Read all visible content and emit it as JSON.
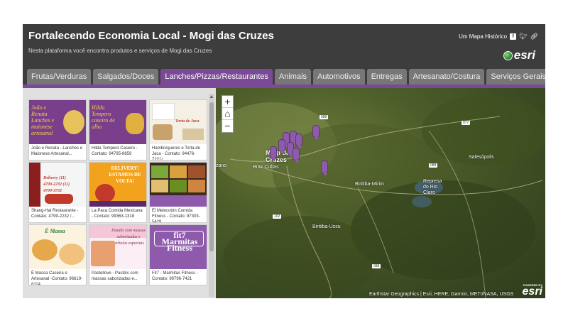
{
  "header": {
    "title": "Fortalecendo Economia Local - Mogi das Cruzes",
    "subtitle": "Nesta plataforma você encontra produtos e serviços de Mogi das Cruzes",
    "story_label": "Um Mapa Histórico",
    "logo_text": "esri"
  },
  "tabs": [
    {
      "label": "Frutas/Verduras"
    },
    {
      "label": "Salgados/Doces"
    },
    {
      "label": "Lanches/Pizzas/Restaurantes"
    },
    {
      "label": "Animais"
    },
    {
      "label": "Automotivos"
    },
    {
      "label": "Entregas"
    },
    {
      "label": "Artesanato/Costura"
    },
    {
      "label": "Serviços Gerais"
    }
  ],
  "active_tab": "Lanches/Pizzas/Restaurantes",
  "cards": [
    {
      "caption": "João e Renata - Lanches e Maionese Artesanal...",
      "thumb_text": "João e Renata\nLanches e maionese artesanal"
    },
    {
      "caption": "Hilda Tempero Caseiro - Contato: 94795-8659",
      "thumb_text": "Hilda\nTempero caseiro de alho"
    },
    {
      "caption": "Hambúrgueres e Torta de Jaca - Contato: 94476-7221/...",
      "thumb_text": "Torta de Jaca"
    },
    {
      "caption": "Shang-Hai Restaurante - Contato: 4799-2232 /...",
      "thumb_text": "Delivery (11) 4799-2232 (11) 4799-3732"
    },
    {
      "caption": "La Paca Comida Mexicana - Contato: 99363-1318",
      "thumb_text": "DELIVERY! ESTAMOS DE VOLTA!"
    },
    {
      "caption": "El Melocotón Comida Fitness - Contato: 97303-5429",
      "thumb_text": ""
    },
    {
      "caption": "É Massa Caseira e Artesanal -Contato: 96619-8114",
      "thumb_text": "É Massa"
    },
    {
      "caption": "Pastellove - Pastéis com massas saborizadas e...",
      "thumb_text": "Pastéis com massas saborizadas e recheios especiais"
    },
    {
      "caption": "Fit7 - Marmitas Fitness - Contato: 99796-7421",
      "thumb_text": "fit7\nMarmitas Fitness"
    }
  ],
  "map": {
    "places": [
      {
        "name": "Mogi das Cruzes"
      },
      {
        "name": "Braz Cubas"
      },
      {
        "name": "Biritiba-Mirim"
      },
      {
        "name": "Represa do Rio Claro"
      },
      {
        "name": "Salesópolis"
      },
      {
        "name": "Biritiba-Ussu"
      },
      {
        "name": "zano"
      }
    ],
    "attribution": "Earthstar Geographics | Esri, HERE, Garmin, METI/NASA, USGS",
    "powered_by": "POWERED BY",
    "powered_logo": "esri"
  },
  "colors": {
    "accent": "#7b4a96",
    "header_bg": "#3d3d3d",
    "tab_bg": "#777777",
    "sidebar_bg": "#e0e0e0"
  },
  "icons": [
    "facebook-icon",
    "twitter-icon",
    "link-icon",
    "esri-globe-icon",
    "zoom-in-icon",
    "home-icon",
    "zoom-out-icon",
    "scroll-up-icon"
  ]
}
